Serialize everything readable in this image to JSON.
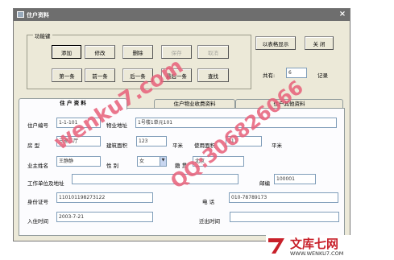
{
  "window": {
    "title": "住户资料",
    "close": "×"
  },
  "toolbar": {
    "group_label": "功能键",
    "add": "添加",
    "edit": "修改",
    "delete": "删除",
    "save": "保存",
    "cancel": "取消",
    "first": "第一条",
    "prev": "前一条",
    "next": "后一条",
    "last": "最后一条",
    "find": "查找",
    "table_view": "以表格显示",
    "close_label": "关 闭",
    "total_label": "共有:",
    "total_value": "6",
    "records_suffix": "记录"
  },
  "tabs": [
    {
      "label": "住 户 资 料"
    },
    {
      "label": "住户物业收费资料"
    },
    {
      "label": "住户其他资料"
    }
  ],
  "form": {
    "owner_no_label": "住户编号",
    "owner_no": "1-1-101",
    "property_addr_label": "物业地址",
    "property_addr": "1号楼1单元101",
    "house_type_label": "房    型",
    "house_type": "三室二厅",
    "build_area_label": "建筑面积",
    "build_area": "123",
    "unit_sqm": "平米",
    "use_area_label": "使用面积",
    "use_area": "111",
    "owner_name_label": "业主姓名",
    "owner_name": "王静静",
    "gender_label": "性   别",
    "gender": "女",
    "native_label": "籍 贯",
    "native": "北京",
    "work_label": "工作单位及地址",
    "work": "",
    "postcode_label": "邮编",
    "postcode": "100001",
    "id_label": "身份证号",
    "id_no": "110101198273122",
    "phone_label": "电    话",
    "phone": "010-78789173",
    "movein_label": "入住时间",
    "movein": "2003-7-21",
    "moveout_label": "迁出时间",
    "moveout": ""
  },
  "watermarks": {
    "site": "wenku7.com",
    "qq": "QQ:306826066",
    "logo": "文库七网",
    "logo_url": "WWW.WENKU7.COM"
  }
}
